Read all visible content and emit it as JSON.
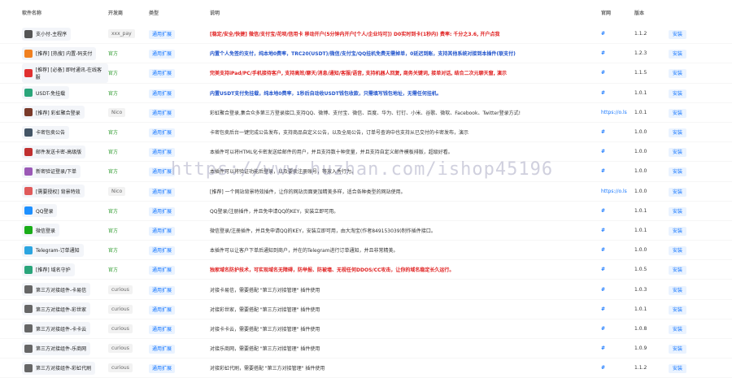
{
  "header": {
    "name": "软件名称",
    "dev": "开发商",
    "type": "类型",
    "desc": "说明",
    "site": "官网",
    "ver": "版本"
  },
  "colors": {
    "accent": "#1677ff",
    "red": "#e02020",
    "green": "#2e9b2e"
  },
  "rows": [
    {
      "name": "支小付-主程序",
      "icon": "#555555",
      "dev": "xxx_pay",
      "type": "通用扩展",
      "desc": "[稳定/安全/快捷] 微信/支付宝/花呗/信用卡 移动开户(5分钟内开户[个人/企业均可]) D0实时到卡(1秒内) 费率: 千分之3.6, 开户点我",
      "site": "#",
      "ver": "1.1.2",
      "act": "安装"
    },
    {
      "name": "[推荐] [热搜] 内置-码支付",
      "icon": "#f08020",
      "dev": "官方",
      "type": "通用扩展",
      "desc": "内置个人免签约支付，纯本地0费率，TRC20(USDT)/微信/支付宝/QQ挂机免费无需掉单，0延迟到账，支持其他系统对接到本插件(联支付)",
      "site": "#",
      "ver": "1.2.3",
      "act": "安装"
    },
    {
      "name": "[推荐] [必备] 即时通讯-在线客服",
      "icon": "#e03030",
      "dev": "官方",
      "type": "通用扩展",
      "desc": "完美支持iPad/PC/手机接待客户, 支持高效/聊天/消息/通知/客服/语音, 支持机器人回复, 商务关键词, 接单对话, 结合二次元聊天窗, 演示",
      "site": "#",
      "ver": "1.1.5",
      "act": "安装"
    },
    {
      "name": "USDT-免挂载",
      "icon": "#2aa57a",
      "dev": "官方",
      "type": "通用扩展",
      "desc": "内置USDT支付免挂载，纯本地0费率，1秒后自动收USDT钱包收款，只需填写钱包地址，无需任何挂机。",
      "site": "#",
      "ver": "1.0.1",
      "act": "安装"
    },
    {
      "name": "[推荐] 彩虹聚合登录",
      "icon": "#7a3a2a",
      "dev": "Nico",
      "type": "通用扩展",
      "desc": "彩虹聚合登录,集合众多第三方登录接口,支持QQ、微博、支付宝、微信、百度、华为、钉钉、小米、谷歌、微软、Facebook、Twitter登录方式!",
      "site": "https://o.ls",
      "ver": "1.0.1",
      "act": "安装"
    },
    {
      "name": "卡密包卖公告",
      "icon": "#445566",
      "dev": "官方",
      "type": "通用扩展",
      "desc": "卡密包卖后台一键完成公告发布，支持商品自定义公告，以及全局公告，订单号查询中也支持从已交付的卡密发布，演示",
      "site": "#",
      "ver": "1.0.0",
      "act": "安装"
    },
    {
      "name": "邮件发送卡密-高级版",
      "icon": "#c03030",
      "dev": "官方",
      "type": "通用扩展",
      "desc": "本插件可以将HTML化卡密发送给邮件的用户，并且支持数十种变量，并且支持自定义邮件模板排版，超级好看。",
      "site": "#",
      "ver": "1.0.0",
      "act": "安装"
    },
    {
      "name": "新密验证登录/下单",
      "icon": "#9b59b6",
      "dev": "官方",
      "type": "通用扩展",
      "desc": "本插件可以将验证功能后登录，以及要卖注册账号，等放入秀行为。",
      "site": "#",
      "ver": "1.0.0",
      "act": "安装"
    },
    {
      "name": "[需要授权] 背景特效",
      "icon": "#e05a5a",
      "dev": "Nico",
      "type": "通用扩展",
      "desc": "[推荐] 一个网站背景特效插件，让你的网站页面更加精美多样，适合各种类型的网站使用。",
      "site": "https://o.ls",
      "ver": "1.0.0",
      "act": "安装"
    },
    {
      "name": "QQ登录",
      "icon": "#1e90ff",
      "dev": "官方",
      "type": "通用扩展",
      "desc": "QQ登录/注册插件，并且免申请QQ的KEY，安装立即可用。",
      "site": "#",
      "ver": "1.0.1",
      "act": "安装"
    },
    {
      "name": "微信登录",
      "icon": "#1aad19",
      "dev": "官方",
      "type": "通用扩展",
      "desc": "微信登录/注册插件，并且免申请QQ的KEY，安装立即可用，由大淘宝(作者849153039)制作插件接口。",
      "site": "#",
      "ver": "1.0.1",
      "act": "安装"
    },
    {
      "name": "Telegram-订单通知",
      "icon": "#2ca5e0",
      "dev": "官方",
      "type": "通用扩展",
      "desc": "本插件可以让客户下单后通知到商户，并在的Telegram进行订单通知，并且非常精美。",
      "site": "#",
      "ver": "1.0.0",
      "act": "安装"
    },
    {
      "name": "[推荐] 域名守护",
      "icon": "#2aa57a",
      "dev": "官方",
      "type": "通用扩展",
      "desc": "独家域名防护技术，可实现域名无障碍，防举报、防被墙、无视任何DDOS/CC攻击，让你的域名稳定长久运行。",
      "site": "#",
      "ver": "1.0.5",
      "act": "安装"
    },
    {
      "name": "第三方对接组件-卡易信",
      "icon": "#666666",
      "dev": "curious",
      "type": "通用扩展",
      "desc": "对接卡易信，需要搭配 \"第三方对接管理\" 插件使用",
      "site": "#",
      "ver": "1.0.3",
      "act": "安装"
    },
    {
      "name": "第三方对接组件-彩世家",
      "icon": "#666666",
      "dev": "curious",
      "type": "通用扩展",
      "desc": "对接彩世家，需要搭配 \"第三方对接管理\" 插件使用",
      "site": "#",
      "ver": "1.0.1",
      "act": "安装"
    },
    {
      "name": "第三方对接组件-卡卡云",
      "icon": "#666666",
      "dev": "curious",
      "type": "通用扩展",
      "desc": "对接卡卡云，需要搭配 \"第三方对接管理\" 插件使用",
      "site": "#",
      "ver": "1.0.8",
      "act": "安装"
    },
    {
      "name": "第三方对接组件-乐商网",
      "icon": "#666666",
      "dev": "curious",
      "type": "通用扩展",
      "desc": "对接乐商网，需要搭配 \"第三方对接管理\" 插件使用",
      "site": "#",
      "ver": "1.0.9",
      "act": "安装"
    },
    {
      "name": "第三方对接组件-彩虹代刷",
      "icon": "#666666",
      "dev": "curious",
      "type": "通用扩展",
      "desc": "对接彩虹代刷，需要搭配 \"第三方对接管理\" 插件使用",
      "site": "#",
      "ver": "1.1.2",
      "act": "安装"
    }
  ],
  "watermark": "https://www.huzhan.com/ishop45196"
}
